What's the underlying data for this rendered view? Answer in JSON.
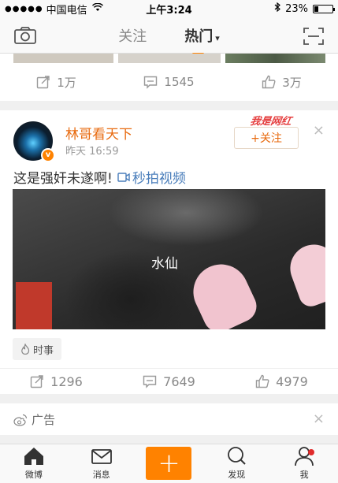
{
  "status_bar": {
    "signal_dots": "●●●●●",
    "carrier": "中国电信",
    "time": "上午3:24",
    "battery_percent": "23%",
    "battery_level": 0.23
  },
  "nav": {
    "tab_follow": "关注",
    "tab_hot": "热门",
    "caret": "▾"
  },
  "prev_post": {
    "reposts": "1万",
    "comments": "1545",
    "likes": "3万"
  },
  "post": {
    "username": "林哥看天下",
    "timestamp": "昨天 16:59",
    "follow_label": "+关注",
    "watermark": "我是网红",
    "close": "×",
    "text": "这是强奸未遂啊!",
    "video_link": "秒拍视频",
    "video_overlay": "水仙",
    "topic": "时事",
    "reposts": "1296",
    "comments": "7649",
    "likes": "4979"
  },
  "ad": {
    "label": "广告",
    "close": "×"
  },
  "tabbar": {
    "home": "微博",
    "messages": "消息",
    "compose": "+",
    "discover": "发现",
    "me": "我"
  },
  "colors": {
    "accent": "#ff8200",
    "username": "#e86b10",
    "link": "#4a7ebb"
  }
}
